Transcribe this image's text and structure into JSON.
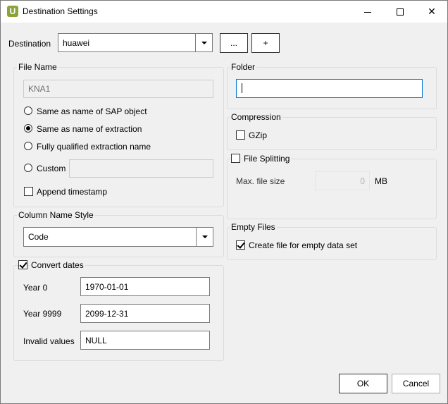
{
  "window": {
    "title": "Destination Settings",
    "app_icon_letter": "U",
    "accent": "#8aa43a"
  },
  "destination": {
    "label": "Destination",
    "value": "huawei",
    "browse_label": "...",
    "add_label": "+"
  },
  "file_name": {
    "legend": "File Name",
    "name_value": "KNA1",
    "options": [
      {
        "label": "Same as name of SAP object",
        "checked": false
      },
      {
        "label": "Same as name of extraction",
        "checked": true
      },
      {
        "label": "Fully qualified extraction name",
        "checked": false
      },
      {
        "label": "Custom",
        "checked": false
      }
    ],
    "custom_value": "",
    "append_timestamp_label": "Append timestamp",
    "append_timestamp_checked": false
  },
  "column_name_style": {
    "legend": "Column Name Style",
    "value": "Code"
  },
  "convert_dates": {
    "legend": "Convert dates",
    "checked": true,
    "year0_label": "Year 0",
    "year0_value": "1970-01-01",
    "year9999_label": "Year 9999",
    "year9999_value": "2099-12-31",
    "invalid_label": "Invalid values",
    "invalid_value": "NULL"
  },
  "folder": {
    "legend": "Folder",
    "value": ""
  },
  "compression": {
    "legend": "Compression",
    "gzip_label": "GZip",
    "gzip_checked": false
  },
  "file_splitting": {
    "legend": "File Splitting",
    "checked": false,
    "max_size_label": "Max. file size",
    "max_size_value": "0",
    "unit": "MB"
  },
  "empty_files": {
    "legend": "Empty Files",
    "create_label": "Create file for empty data set",
    "create_checked": true
  },
  "footer": {
    "ok_label": "OK",
    "cancel_label": "Cancel"
  }
}
